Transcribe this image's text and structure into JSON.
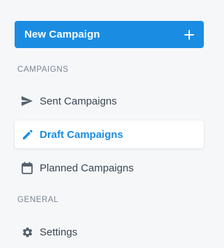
{
  "new_campaign_button": {
    "label": "New Campaign",
    "icon": "plus-icon"
  },
  "sections": {
    "campaigns": {
      "label": "CAMPAIGNS",
      "items": [
        {
          "label": "Sent Campaigns",
          "icon": "send-icon"
        },
        {
          "label": "Draft Campaigns",
          "icon": "pencil-icon",
          "active": true
        },
        {
          "label": "Planned Campaigns",
          "icon": "calendar-icon"
        }
      ]
    },
    "general": {
      "label": "GENERAL",
      "items": [
        {
          "label": "Settings",
          "icon": "gear-icon"
        }
      ]
    }
  },
  "colors": {
    "accent": "#1a8de3",
    "text": "#3b4753",
    "muted": "#7a8590",
    "background": "#f6f7f9"
  }
}
